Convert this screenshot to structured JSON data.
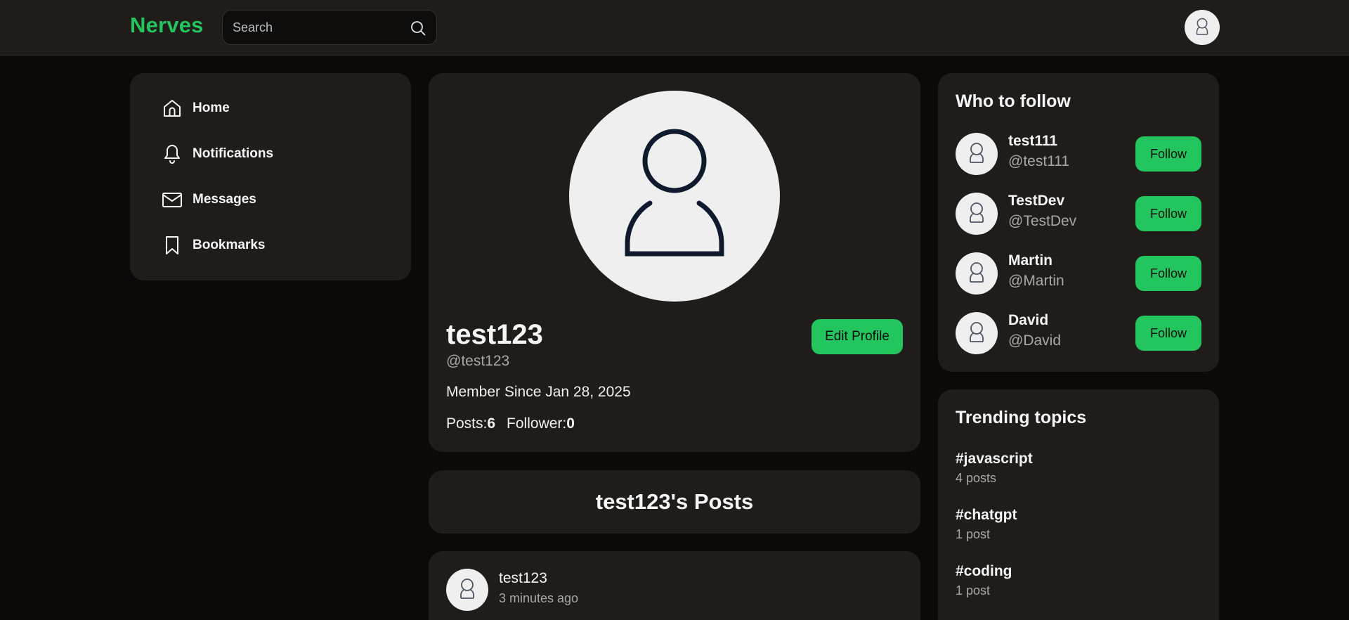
{
  "header": {
    "logo": "Nerves",
    "search_placeholder": "Search",
    "icons": {
      "search": "search-icon",
      "avatar": "user-avatar-icon"
    }
  },
  "colors": {
    "accent": "#22c55e",
    "background": "#0b0a09",
    "card": "#1f1c1a",
    "muted_text": "#a8a8a8"
  },
  "sidebar": {
    "items": [
      {
        "label": "Home",
        "icon": "home-icon"
      },
      {
        "label": "Notifications",
        "icon": "bell-icon"
      },
      {
        "label": "Messages",
        "icon": "mail-icon"
      },
      {
        "label": "Bookmarks",
        "icon": "bookmark-icon"
      }
    ]
  },
  "profile": {
    "name": "test123",
    "handle": "@test123",
    "member_since": "Member Since Jan 28, 2025",
    "posts_label": "Posts:",
    "posts_count": "6",
    "followers_label": "Follower:",
    "followers_count": "0",
    "edit_button": "Edit Profile"
  },
  "posts_section": {
    "title": "test123's Posts",
    "posts": [
      {
        "author": "test123",
        "time": "3 minutes ago"
      }
    ]
  },
  "who_to_follow": {
    "title": "Who to follow",
    "button_label": "Follow",
    "users": [
      {
        "name": "test111",
        "handle": "@test111"
      },
      {
        "name": "TestDev",
        "handle": "@TestDev"
      },
      {
        "name": "Martin",
        "handle": "@Martin"
      },
      {
        "name": "David",
        "handle": "@David"
      }
    ]
  },
  "trending": {
    "title": "Trending topics",
    "topics": [
      {
        "tag": "#javascript",
        "count": "4 posts"
      },
      {
        "tag": "#chatgpt",
        "count": "1 post"
      },
      {
        "tag": "#coding",
        "count": "1 post"
      }
    ]
  }
}
